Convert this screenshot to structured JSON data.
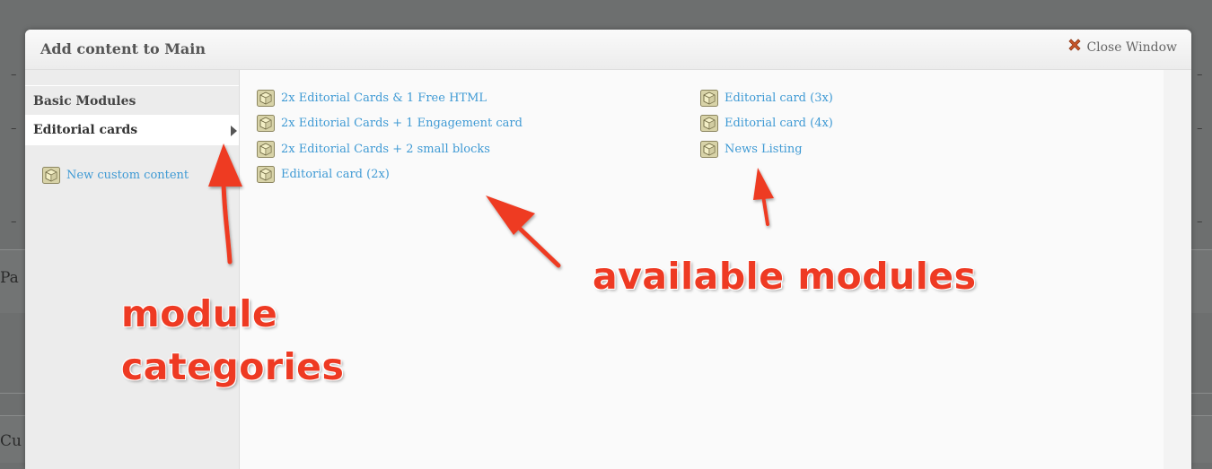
{
  "background": {
    "left_text_1": "Pa",
    "left_text_2": "Cu"
  },
  "modal": {
    "title": "Add content to Main",
    "close_label": "Close Window"
  },
  "sidebar": {
    "categories": [
      {
        "label": "Basic Modules"
      },
      {
        "label": "Editorial cards",
        "active": true
      }
    ],
    "custom_content_label": "New custom content"
  },
  "modules": {
    "column_1": [
      "2x Editorial Cards & 1 Free HTML",
      "2x Editorial Cards + 1 Engagement card",
      "2x Editorial Cards + 2 small blocks",
      "Editorial card (2x)"
    ],
    "column_2": [
      "Editorial card (3x)",
      "Editorial card (4x)",
      "News Listing"
    ]
  },
  "annotations": {
    "module_categories_line1": "module",
    "module_categories_line2": "categories",
    "available_modules": "available modules"
  },
  "colors": {
    "link": "#3f9ad4",
    "annotation": "#ee3a23",
    "overlay": "#6d6f6f"
  },
  "icons": {
    "module": "cube-icon",
    "close": "close-x-icon",
    "active_category": "chevron-right-icon"
  }
}
